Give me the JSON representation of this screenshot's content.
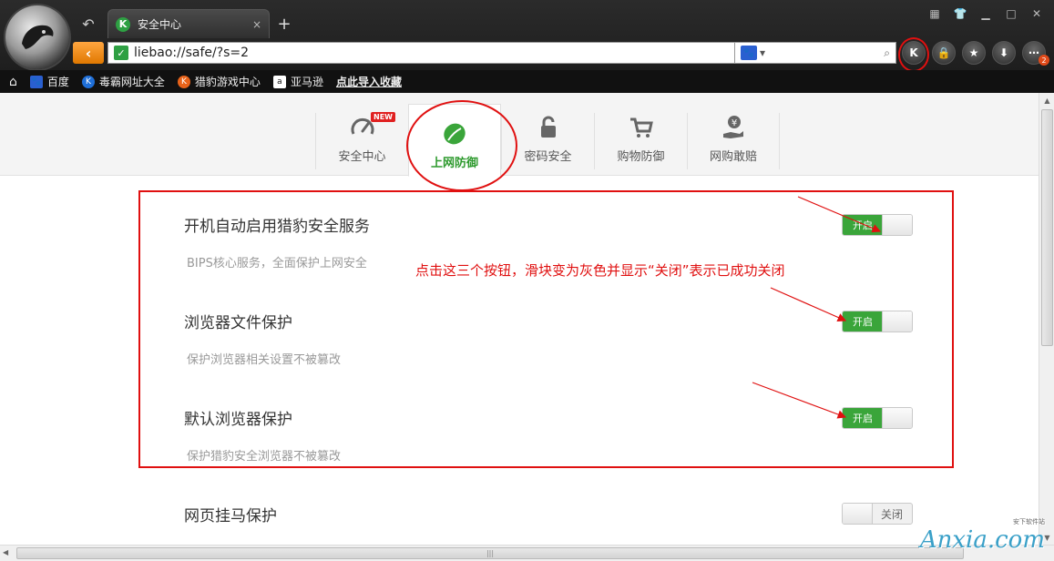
{
  "browser": {
    "tab_title": "安全中心",
    "tab_favicon_letter": "K",
    "new_tab": "+",
    "close_tab": "×",
    "address": "liebao://safe/?s=2",
    "account_button": "K",
    "notification_count": "2"
  },
  "bookmarks": [
    {
      "label": "百度",
      "icon": "baidu-paw-icon",
      "color": "#2a5fd0"
    },
    {
      "label": "毒霸网址大全",
      "icon": "duba-k-icon",
      "color": "#1f6fd8"
    },
    {
      "label": "猎豹游戏中心",
      "icon": "game-icon",
      "color": "#e8631a"
    },
    {
      "label": "亚马逊",
      "icon": "amazon-icon",
      "color": "#ffffff"
    },
    {
      "label": "点此导入收藏",
      "icon": "",
      "color": ""
    }
  ],
  "nav_tabs": [
    {
      "label": "安全中心",
      "icon": "speedometer-icon",
      "badge": "NEW"
    },
    {
      "label": "上网防御",
      "icon": "leaf-shield-icon",
      "active": true
    },
    {
      "label": "密码安全",
      "icon": "lock-icon"
    },
    {
      "label": "购物防御",
      "icon": "cart-icon"
    },
    {
      "label": "网购敢赔",
      "icon": "yen-hand-icon"
    }
  ],
  "settings": [
    {
      "title": "开机自动启用猎豹安全服务",
      "desc": "BIPS核心服务，全面保护上网安全",
      "state": "开启"
    },
    {
      "title": "浏览器文件保护",
      "desc": "保护浏览器相关设置不被篡改",
      "state": "开启"
    },
    {
      "title": "默认浏览器保护",
      "desc": "保护猎豹安全浏览器不被篡改",
      "state": "开启"
    },
    {
      "title": "网页挂马保护",
      "desc": "",
      "state": "关闭"
    }
  ],
  "annotation": "点击这三个按钮，滑块变为灰色并显示“关闭”表示已成功关闭",
  "watermark": {
    "text": "Anxia.com",
    "small": "安下软件站"
  },
  "colors": {
    "accent_green": "#3aa53a",
    "highlight_red": "#e01010",
    "back_orange": "#f08a10"
  }
}
